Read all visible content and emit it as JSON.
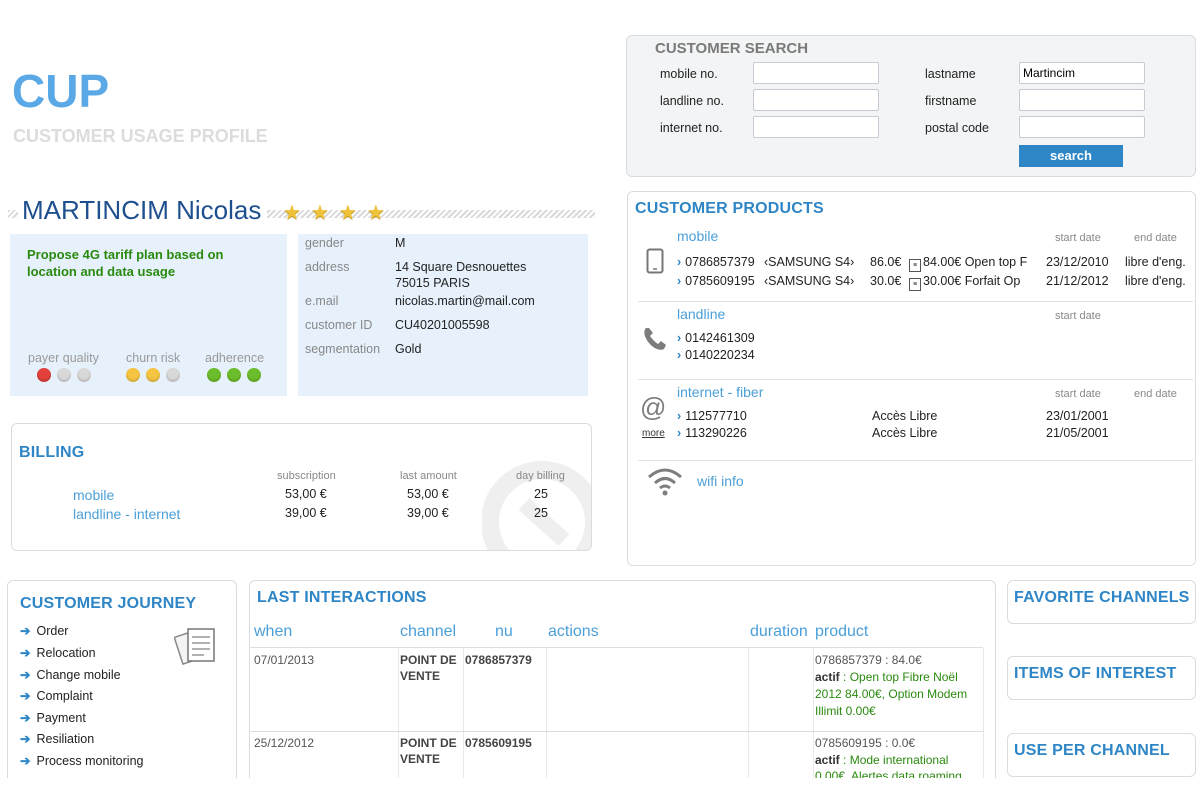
{
  "app": {
    "logo": "CUP",
    "subtitle": "CUSTOMER USAGE PROFILE"
  },
  "search": {
    "title": "CUSTOMER SEARCH",
    "labels": {
      "mobile": "mobile no.",
      "landline": "landline no.",
      "internet": "internet no.",
      "lastname": "lastname",
      "firstname": "firstname",
      "postal": "postal code"
    },
    "values": {
      "mobile": "",
      "landline": "",
      "internet": "",
      "lastname": "Martincim",
      "firstname": "",
      "postal": ""
    },
    "button": "search"
  },
  "customer": {
    "name": "MARTINCIM Nicolas",
    "stars": 4,
    "recommendation": "Propose 4G tariff plan based on location and data usage",
    "indicators": [
      {
        "label": "payer quality",
        "dots": [
          "#e2403a",
          "#d8d8d8",
          "#d8d8d8"
        ]
      },
      {
        "label": "churn risk",
        "dots": [
          "#f5c542",
          "#f5c542",
          "#d8d8d8"
        ]
      },
      {
        "label": "adherence",
        "dots": [
          "#6cbd2b",
          "#6cbd2b",
          "#6cbd2b"
        ]
      }
    ],
    "details": {
      "gender_label": "gender",
      "gender": "M",
      "address_label": "address",
      "address_line1": "14 Square Desnouettes",
      "address_line2": "75015 PARIS",
      "email_label": "e.mail",
      "email": "nicolas.martin@mail.com",
      "id_label": "customer ID",
      "id": "CU40201005598",
      "segmentation_label": "segmentation",
      "segmentation": "Gold"
    }
  },
  "billing": {
    "title": "BILLING",
    "headers": {
      "subscription": "subscription",
      "last_amount": "last amount",
      "day_billing": "day billing"
    },
    "rows": [
      {
        "name": "mobile",
        "subscription": "53,00 €",
        "last_amount": "53,00 €",
        "day": "25"
      },
      {
        "name": "landline - internet",
        "subscription": "39,00 €",
        "last_amount": "39,00 €",
        "day": "25"
      }
    ]
  },
  "products": {
    "title": "CUSTOMER PRODUCTS",
    "start_label": "start date",
    "end_label": "end date",
    "mobile": {
      "title": "mobile",
      "rows": [
        {
          "number": "0786857379",
          "device": "‹SAMSUNG S4›",
          "price": "86.0€",
          "offer": "84.00€ Open top F",
          "start": "23/12/2010",
          "end": "libre d'eng."
        },
        {
          "number": "0785609195",
          "device": "‹SAMSUNG S4›",
          "price": "30.0€",
          "offer": "30.00€ Forfait Op",
          "start": "21/12/2012",
          "end": "libre d'eng."
        }
      ]
    },
    "landline": {
      "title": "landline",
      "rows": [
        "0142461309",
        "0140220234"
      ]
    },
    "internet": {
      "title": "internet - fiber",
      "more": "more",
      "rows": [
        {
          "number": "112577710",
          "offer": "Accès Libre",
          "start": "23/01/2001"
        },
        {
          "number": "113290226",
          "offer": "Accès Libre",
          "start": "21/05/2001"
        }
      ]
    },
    "wifi": "wifi info"
  },
  "journey": {
    "title": "CUSTOMER JOURNEY",
    "items": [
      "Order",
      "Relocation",
      "Change mobile",
      "Complaint",
      "Payment",
      "Resiliation",
      "Process monitoring"
    ]
  },
  "interactions": {
    "title": "LAST INTERACTIONS",
    "columns": {
      "when": "when",
      "channel": "channel",
      "nu": "nu",
      "actions": "actions",
      "duration": "duration",
      "product": "product"
    },
    "rows": [
      {
        "when": "07/01/2013",
        "channel_1": "POINT DE",
        "channel_2": "VENTE",
        "nu": "0786857379",
        "product_head": "0786857379 : 84.0€",
        "actif": "actif",
        "product_lines": [
          ": Open top Fibre Noël",
          "2012 84.00€, Option Modem",
          "Illimit 0.00€"
        ]
      },
      {
        "when": "25/12/2012",
        "channel_1": "POINT DE",
        "channel_2": "VENTE",
        "nu": "0785609195",
        "product_head": "0785609195 : 0.0€",
        "actif": "actif",
        "product_lines": [
          ": Mode international",
          "0.00€, Alertes data roaming"
        ]
      }
    ]
  },
  "side": {
    "favorite": "FAVORITE CHANNELS",
    "items_interest": "ITEMS OF INTEREST",
    "use_channel": "USE PER CHANNEL"
  },
  "colors": {
    "accent": "#2f86c6",
    "light_panel": "#e7f1fb",
    "green_text": "#2a8a0f",
    "search_button": "#2f86c6"
  }
}
